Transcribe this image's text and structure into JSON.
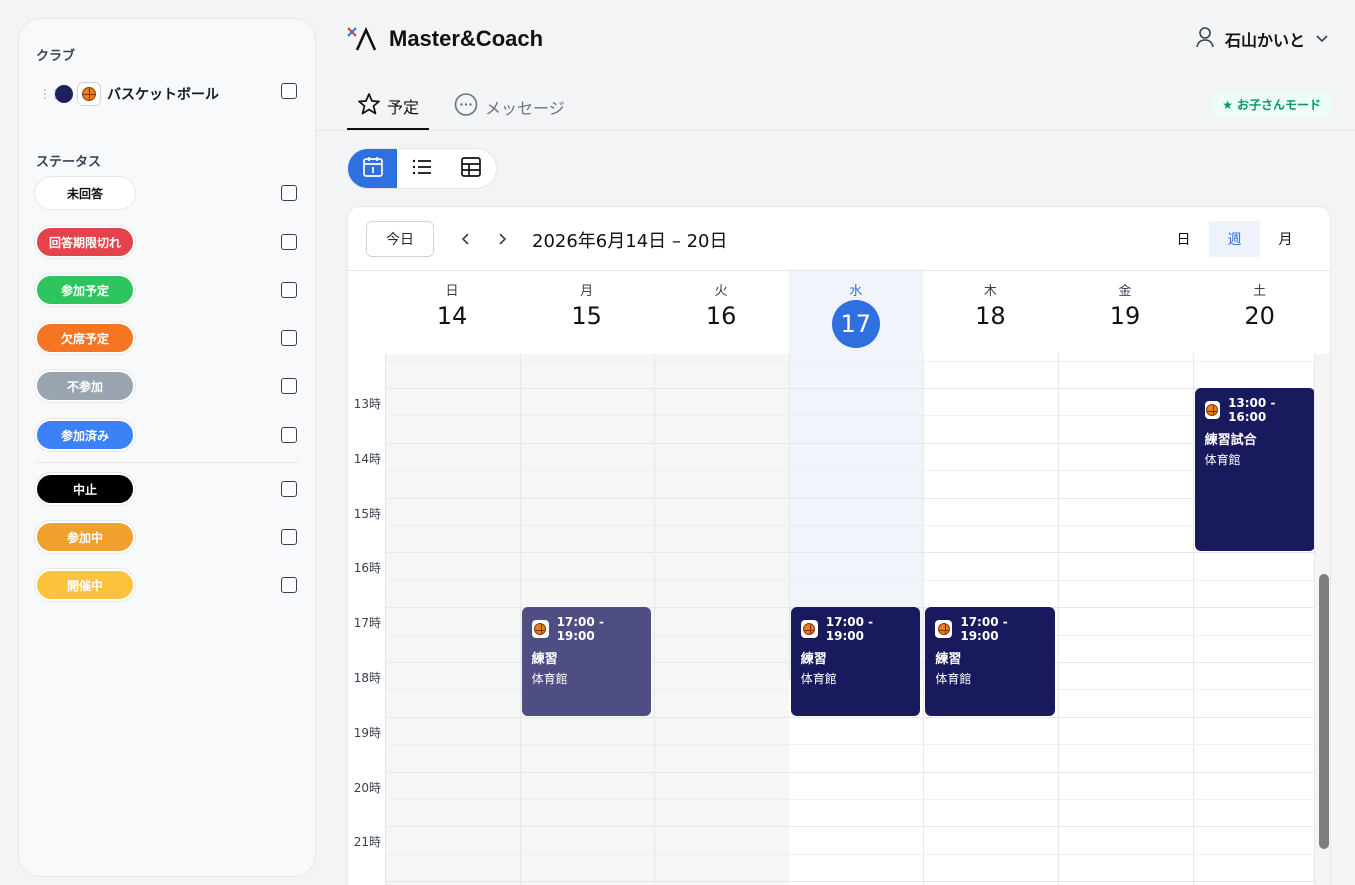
{
  "sidebar": {
    "club_title": "クラブ",
    "club": {
      "name": "バスケットボール",
      "color": "#1e2160"
    },
    "status_title": "ステータス",
    "statuses": [
      {
        "label": "未回答",
        "bg": "#ffffff",
        "fg": "#111111"
      },
      {
        "label": "回答期限切れ",
        "bg": "#e5434b",
        "fg": "#ffffff"
      },
      {
        "label": "参加予定",
        "bg": "#2fc55e",
        "fg": "#ffffff"
      },
      {
        "label": "欠席予定",
        "bg": "#f47524",
        "fg": "#ffffff"
      },
      {
        "label": "不参加",
        "bg": "#9aa4b0",
        "fg": "#ffffff"
      },
      {
        "label": "参加済み",
        "bg": "#3b82f6",
        "fg": "#ffffff"
      }
    ],
    "statuses2": [
      {
        "label": "中止",
        "bg": "#000000",
        "fg": "#ffffff"
      },
      {
        "label": "参加中",
        "bg": "#f0a12b",
        "fg": "#ffffff"
      },
      {
        "label": "開催中",
        "bg": "#fcc23c",
        "fg": "#ffffff"
      }
    ]
  },
  "header": {
    "app_title": "Master&Coach",
    "user_name": "石山かいと",
    "tabs": [
      {
        "label": "予定"
      },
      {
        "label": "メッセージ"
      }
    ],
    "kid_mode": "お子さんモード"
  },
  "calendar": {
    "today_label": "今日",
    "range": "2026年6月14日 – 20日",
    "views": [
      "日",
      "週",
      "月"
    ],
    "days": [
      {
        "wd": "日",
        "num": "14"
      },
      {
        "wd": "月",
        "num": "15"
      },
      {
        "wd": "火",
        "num": "16"
      },
      {
        "wd": "水",
        "num": "17"
      },
      {
        "wd": "木",
        "num": "18"
      },
      {
        "wd": "金",
        "num": "19"
      },
      {
        "wd": "土",
        "num": "20"
      }
    ],
    "hours": [
      "13時",
      "14時",
      "15時",
      "16時",
      "17時",
      "18時",
      "19時",
      "20時",
      "21時"
    ],
    "events": [
      {
        "day": 1,
        "start": 17,
        "end": 19,
        "time": "17:00 - 19:00",
        "title": "練習",
        "place": "体育館",
        "color": "#4e4e85"
      },
      {
        "day": 3,
        "start": 17,
        "end": 19,
        "time": "17:00 - 19:00",
        "title": "練習",
        "place": "体育館",
        "color": "#191a5e"
      },
      {
        "day": 4,
        "start": 17,
        "end": 19,
        "time": "17:00 - 19:00",
        "title": "練習",
        "place": "体育館",
        "color": "#191a5e"
      },
      {
        "day": 6,
        "start": 13,
        "end": 16,
        "time": "13:00 - 16:00",
        "title": "練習試合",
        "place": "体育館",
        "color": "#191a5e"
      }
    ]
  }
}
